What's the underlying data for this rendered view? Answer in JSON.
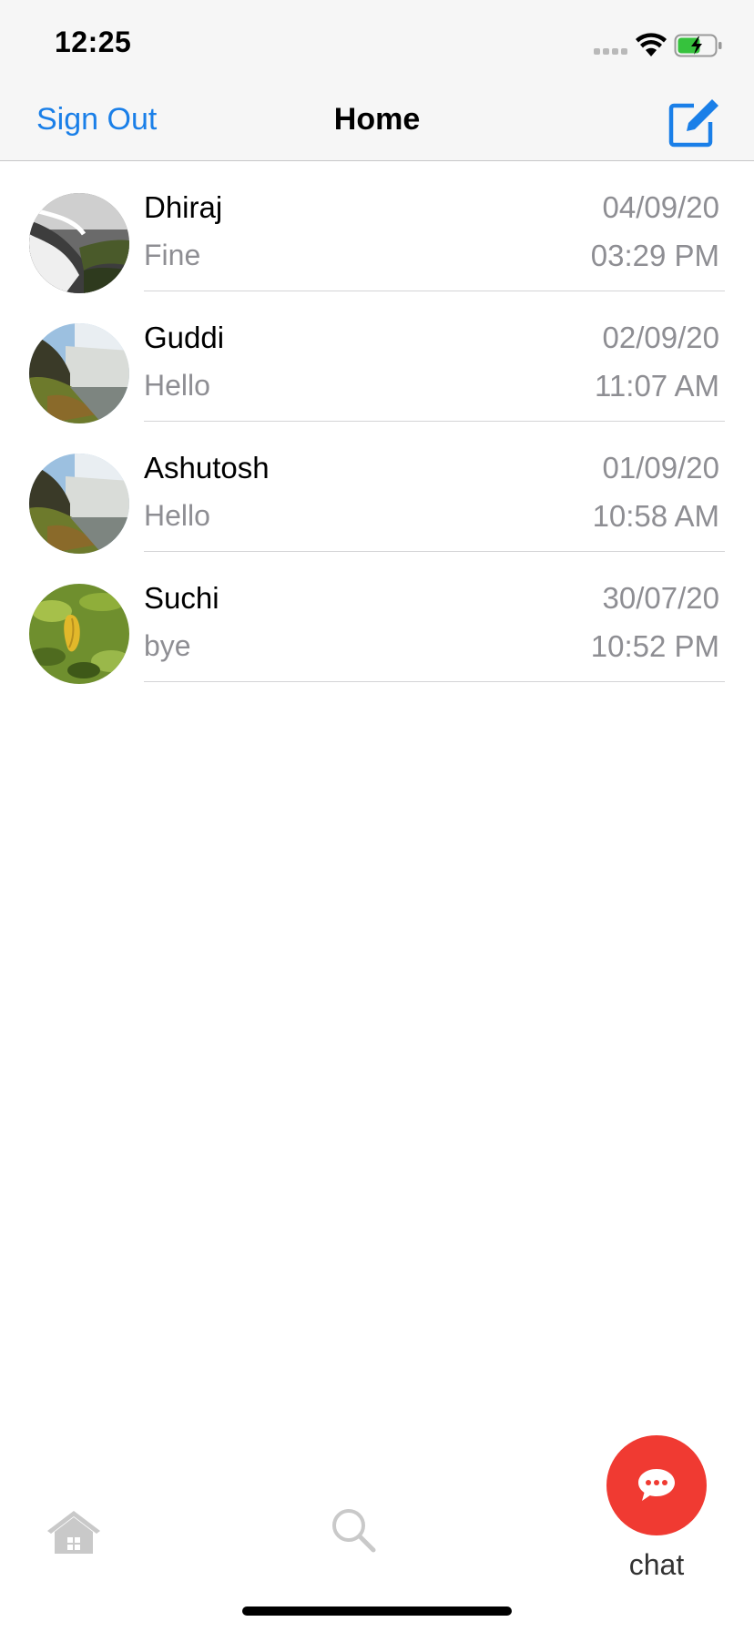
{
  "status_bar": {
    "time": "12:25",
    "icons": [
      "signal-dots-icon",
      "wifi-icon",
      "battery-charging-icon"
    ]
  },
  "nav": {
    "left_action": "Sign Out",
    "title": "Home",
    "right_icon": "compose-icon",
    "accent_color": "#1a7fe8"
  },
  "conversations": [
    {
      "name": "Dhiraj",
      "last_message": "Fine",
      "date": "04/09/20",
      "time": "03:29 PM",
      "avatar": "waterfall-bw-photo"
    },
    {
      "name": "Guddi",
      "last_message": "Hello",
      "date": "02/09/20",
      "time": "11:07 AM",
      "avatar": "waterfall-photo"
    },
    {
      "name": "Ashutosh",
      "last_message": "Hello",
      "date": "01/09/20",
      "time": "10:58 AM",
      "avatar": "waterfall-photo"
    },
    {
      "name": "Suchi",
      "last_message": "bye",
      "date": "30/07/20",
      "time": "10:52 PM",
      "avatar": "green-leaves-photo"
    }
  ],
  "tab_bar": {
    "home_icon": "home-icon",
    "search_icon": "search-icon",
    "chat_icon": "chat-bubble-icon",
    "chat_label": "chat",
    "chat_color": "#f03a32"
  }
}
